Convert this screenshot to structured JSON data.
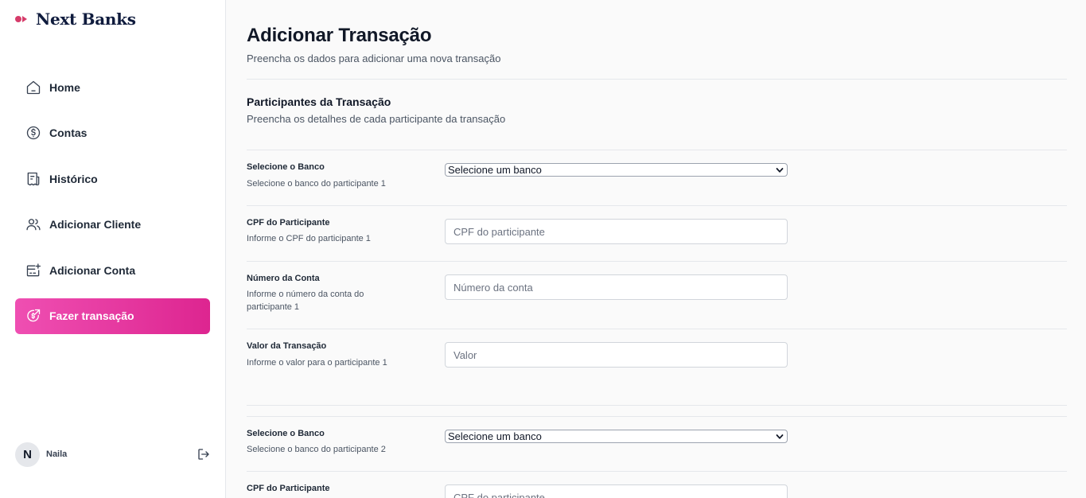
{
  "brand": {
    "name": "Next Banks",
    "accent": "#d63c6a"
  },
  "nav": {
    "items": [
      {
        "label": "Home",
        "icon": "home-icon"
      },
      {
        "label": "Contas",
        "icon": "dollar-circle-icon"
      },
      {
        "label": "Histórico",
        "icon": "receipt-icon"
      },
      {
        "label": "Adicionar Cliente",
        "icon": "users-icon"
      },
      {
        "label": "Adicionar Conta",
        "icon": "card-add-icon"
      },
      {
        "label": "Fazer transação",
        "icon": "coin-transfer-icon",
        "active": true
      }
    ],
    "active_color": "#e32c97"
  },
  "user": {
    "initial": "N",
    "name": "Naila",
    "logout_icon": "logout-icon"
  },
  "header": {
    "title": "Adicionar Transação",
    "subtitle": "Preencha os dados para adicionar uma nova transação"
  },
  "section": {
    "title": "Participantes da Transação",
    "subtitle": "Preencha os detalhes de cada participante da transação"
  },
  "participant1": {
    "bank_label": "Selecione o Banco",
    "bank_help": "Selecione o banco do participante 1",
    "bank_value": "Selecione um banco",
    "cpf_label": "CPF do Participante",
    "cpf_help": "Informe o CPF do participante 1",
    "cpf_placeholder": "CPF do participante",
    "account_label": "Número da Conta",
    "account_help": "Informe o número da conta do participante 1",
    "account_placeholder": "Número da conta",
    "value_label": "Valor da Transação",
    "value_help": "Informe o valor para o participante 1",
    "value_placeholder": "Valor"
  },
  "participant2": {
    "bank_label": "Selecione o Banco",
    "bank_help": "Selecione o banco do participante 2",
    "bank_value": "Selecione um banco",
    "cpf_label": "CPF do Participante",
    "cpf_placeholder": "CPF do participante"
  }
}
